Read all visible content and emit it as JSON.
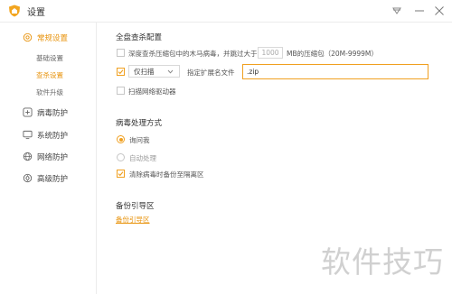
{
  "window": {
    "title": "设置",
    "accent": "#f0a020"
  },
  "sidebar": {
    "items": [
      {
        "label": "常规设置",
        "icon": "gear-icon",
        "active": true
      },
      {
        "label": "病毒防护",
        "icon": "plus-square-icon",
        "active": false
      },
      {
        "label": "系统防护",
        "icon": "monitor-icon",
        "active": false
      },
      {
        "label": "网络防护",
        "icon": "globe-icon",
        "active": false
      },
      {
        "label": "高级防护",
        "icon": "advanced-icon",
        "active": false
      }
    ],
    "sub_items": [
      {
        "label": "基础设置",
        "active": false
      },
      {
        "label": "查杀设置",
        "active": true
      },
      {
        "label": "软件升级",
        "active": false
      }
    ]
  },
  "scan": {
    "title": "全盘查杀配置",
    "deep_scan": {
      "checked": false,
      "text_before": "深度查杀压缩包中的木马病毒，并跳过大于",
      "size_value": "1000",
      "text_after": "MB的压缩包（20M-9999M）"
    },
    "scan_only": {
      "checked": true,
      "select_value": "仅扫描",
      "label": "指定扩展名文件",
      "extension_value": ".zip"
    },
    "network_drive": {
      "checked": false,
      "label": "扫描网络驱动器"
    }
  },
  "virus": {
    "title": "病毒处理方式",
    "options": [
      {
        "label": "询问我",
        "selected": true
      },
      {
        "label": "自动处理",
        "selected": false
      }
    ],
    "backup": {
      "checked": true,
      "label": "清除病毒时备份至隔离区"
    }
  },
  "boot": {
    "title": "备份引导区",
    "link": "备份引导区"
  },
  "watermark": "软件技巧"
}
